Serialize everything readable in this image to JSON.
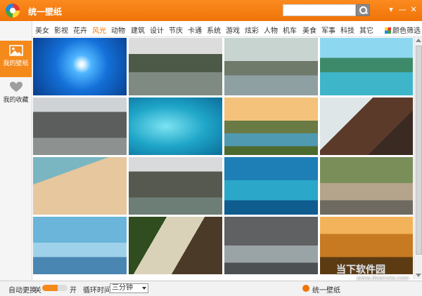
{
  "app": {
    "title": "统一壁纸"
  },
  "search": {
    "placeholder": ""
  },
  "window": {
    "menu_glyph": "▾",
    "minimize_glyph": "—",
    "close_glyph": "✕"
  },
  "sidebar": {
    "items": [
      {
        "label": "我的壁纸",
        "icon": "image-icon"
      },
      {
        "label": "我的收藏",
        "icon": "heart-icon"
      }
    ]
  },
  "categories": {
    "items": [
      "美女",
      "影视",
      "花卉",
      "风光",
      "动物",
      "建筑",
      "设计",
      "节庆",
      "卡通",
      "系统",
      "游戏",
      "炫彩",
      "人物",
      "机车",
      "美食",
      "军事",
      "科技",
      "其它"
    ],
    "active": "风光",
    "color_filter": "颜色筛选"
  },
  "wallpapers": [
    {
      "theme": "sun-underwater"
    },
    {
      "theme": "water-village-boats"
    },
    {
      "theme": "stone-arch-bridge"
    },
    {
      "theme": "halong-bay"
    },
    {
      "theme": "canal-houses"
    },
    {
      "theme": "reef-fish"
    },
    {
      "theme": "karst-sunset"
    },
    {
      "theme": "cafe-1921-sign"
    },
    {
      "theme": "sandy-beach"
    },
    {
      "theme": "canal-boat"
    },
    {
      "theme": "ocean-waves"
    },
    {
      "theme": "rock-garden"
    },
    {
      "theme": "palm-shadow-beach"
    },
    {
      "theme": "wooden-signs"
    },
    {
      "theme": "water-town-rooftops"
    },
    {
      "theme": "golden-sunset-field"
    }
  ],
  "watermark": {
    "text": "当下软件园",
    "sub": "www.downxia.com"
  },
  "footer": {
    "auto_change_label": "自动更换",
    "off_label": "关",
    "on_label": "开",
    "auto_change_level": 0.6,
    "interval_label": "循环时间",
    "interval_value": "三分钟",
    "brand": "统一壁纸"
  },
  "colors": {
    "accent": "#f07408",
    "titlebar": "#f48a1c"
  }
}
